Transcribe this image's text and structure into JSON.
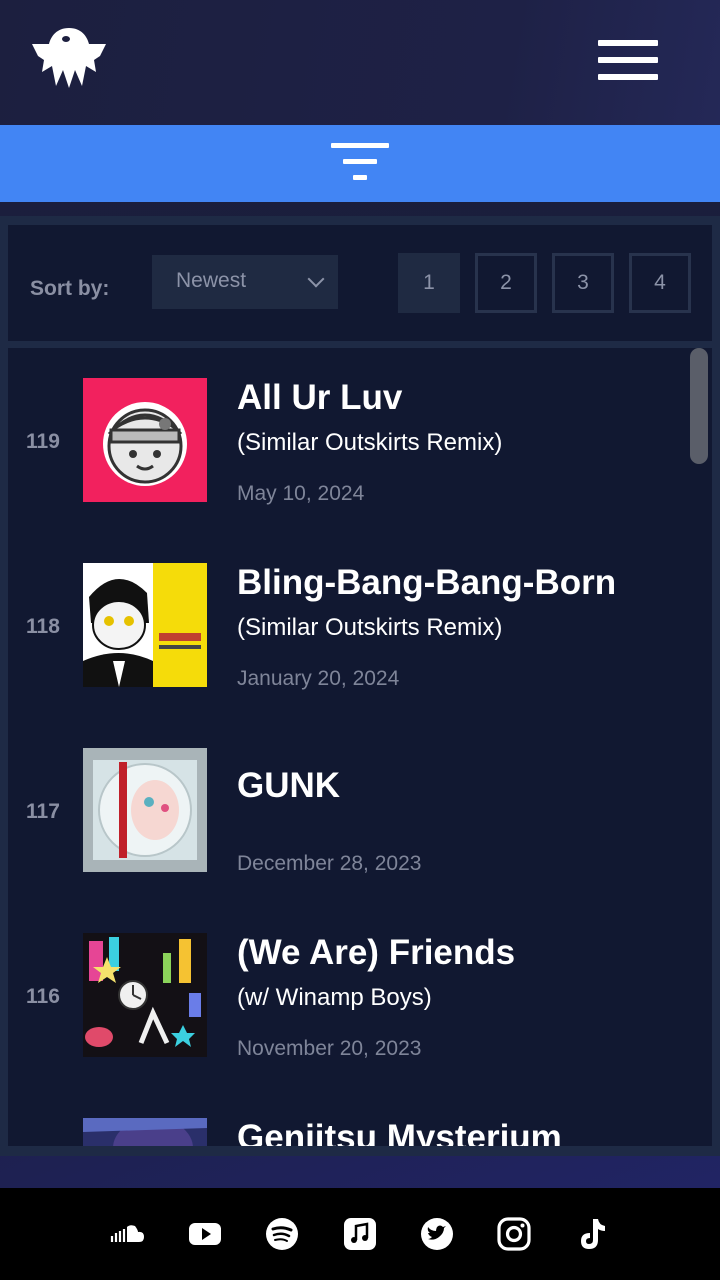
{
  "sort": {
    "label": "Sort by:",
    "selected": "Newest"
  },
  "pagination": [
    "1",
    "2",
    "3",
    "4"
  ],
  "tracks": [
    {
      "number": "119",
      "title": "All Ur Luv",
      "subtitle": "(Similar Outskirts Remix)",
      "date": "May 10, 2024"
    },
    {
      "number": "118",
      "title": "Bling-Bang-Bang-Born",
      "subtitle": "(Similar Outskirts Remix)",
      "date": "January 20, 2024"
    },
    {
      "number": "117",
      "title": "GUNK",
      "subtitle": "",
      "date": "December 28, 2023"
    },
    {
      "number": "116",
      "title": "(We Are) Friends",
      "subtitle": "(w/ Winamp Boys)",
      "date": "November 20, 2023"
    },
    {
      "number": "",
      "title": "Genjitsu Mysterium",
      "subtitle": "",
      "date": ""
    }
  ],
  "colors": {
    "accent": "#4285f4",
    "background": "#1a1d3a",
    "panel": "#111831"
  },
  "icons": [
    "soundcloud-icon",
    "youtube-icon",
    "spotify-icon",
    "apple-music-icon",
    "twitter-icon",
    "instagram-icon",
    "tiktok-icon"
  ]
}
